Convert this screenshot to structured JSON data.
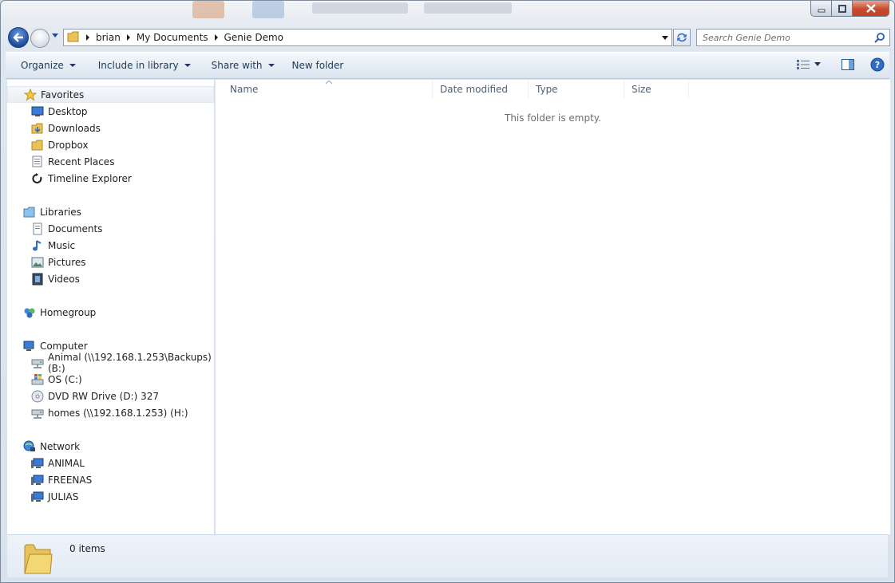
{
  "window": {
    "controls": {
      "minimize": "minimize",
      "maximize": "maximize",
      "close": "close"
    }
  },
  "address": {
    "segments": [
      "brian",
      "My Documents",
      "Genie Demo"
    ]
  },
  "search": {
    "placeholder": "Search Genie Demo"
  },
  "toolbar": {
    "organize": "Organize",
    "include_in_library": "Include in library",
    "share_with": "Share with",
    "new_folder": "New folder"
  },
  "navigation": {
    "favorites": {
      "label": "Favorites",
      "items": [
        "Desktop",
        "Downloads",
        "Dropbox",
        "Recent Places",
        "Timeline Explorer"
      ]
    },
    "libraries": {
      "label": "Libraries",
      "items": [
        "Documents",
        "Music",
        "Pictures",
        "Videos"
      ]
    },
    "homegroup": {
      "label": "Homegroup"
    },
    "computer": {
      "label": "Computer",
      "items": [
        "Animal (\\\\192.168.1.253\\Backups) (B:)",
        "OS (C:)",
        "DVD RW Drive (D:) 327",
        "homes (\\\\192.168.1.253) (H:)"
      ]
    },
    "network": {
      "label": "Network",
      "items": [
        "ANIMAL",
        "FREENAS",
        "JULIAS"
      ]
    }
  },
  "columns": {
    "name": "Name",
    "date_modified": "Date modified",
    "type": "Type",
    "size": "Size"
  },
  "content": {
    "empty_message": "This folder is empty."
  },
  "details": {
    "item_count": "0 items"
  },
  "colors": {
    "accent": "#1e395b",
    "column_header_text": "#4c607a",
    "close_button": "#c74a2e"
  }
}
